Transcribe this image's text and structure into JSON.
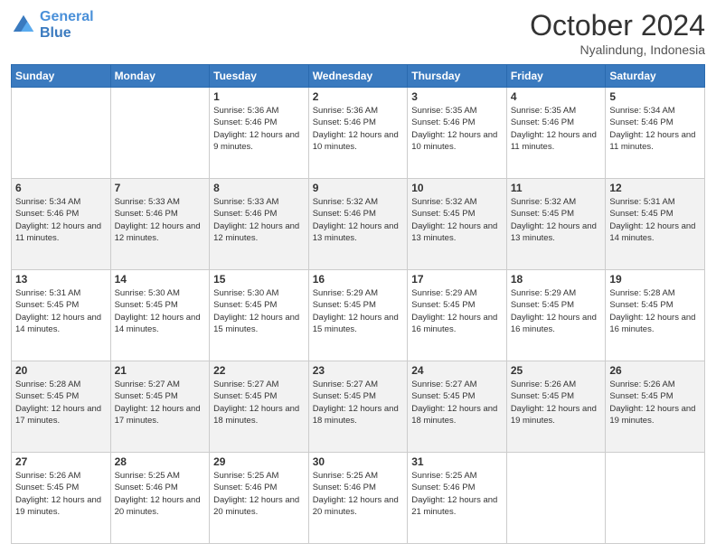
{
  "header": {
    "logo_line1": "General",
    "logo_line2": "Blue",
    "month": "October 2024",
    "location": "Nyalindung, Indonesia"
  },
  "weekdays": [
    "Sunday",
    "Monday",
    "Tuesday",
    "Wednesday",
    "Thursday",
    "Friday",
    "Saturday"
  ],
  "weeks": [
    [
      {
        "day": "",
        "sunrise": "",
        "sunset": "",
        "daylight": ""
      },
      {
        "day": "",
        "sunrise": "",
        "sunset": "",
        "daylight": ""
      },
      {
        "day": "1",
        "sunrise": "Sunrise: 5:36 AM",
        "sunset": "Sunset: 5:46 PM",
        "daylight": "Daylight: 12 hours and 9 minutes."
      },
      {
        "day": "2",
        "sunrise": "Sunrise: 5:36 AM",
        "sunset": "Sunset: 5:46 PM",
        "daylight": "Daylight: 12 hours and 10 minutes."
      },
      {
        "day": "3",
        "sunrise": "Sunrise: 5:35 AM",
        "sunset": "Sunset: 5:46 PM",
        "daylight": "Daylight: 12 hours and 10 minutes."
      },
      {
        "day": "4",
        "sunrise": "Sunrise: 5:35 AM",
        "sunset": "Sunset: 5:46 PM",
        "daylight": "Daylight: 12 hours and 11 minutes."
      },
      {
        "day": "5",
        "sunrise": "Sunrise: 5:34 AM",
        "sunset": "Sunset: 5:46 PM",
        "daylight": "Daylight: 12 hours and 11 minutes."
      }
    ],
    [
      {
        "day": "6",
        "sunrise": "Sunrise: 5:34 AM",
        "sunset": "Sunset: 5:46 PM",
        "daylight": "Daylight: 12 hours and 11 minutes."
      },
      {
        "day": "7",
        "sunrise": "Sunrise: 5:33 AM",
        "sunset": "Sunset: 5:46 PM",
        "daylight": "Daylight: 12 hours and 12 minutes."
      },
      {
        "day": "8",
        "sunrise": "Sunrise: 5:33 AM",
        "sunset": "Sunset: 5:46 PM",
        "daylight": "Daylight: 12 hours and 12 minutes."
      },
      {
        "day": "9",
        "sunrise": "Sunrise: 5:32 AM",
        "sunset": "Sunset: 5:46 PM",
        "daylight": "Daylight: 12 hours and 13 minutes."
      },
      {
        "day": "10",
        "sunrise": "Sunrise: 5:32 AM",
        "sunset": "Sunset: 5:45 PM",
        "daylight": "Daylight: 12 hours and 13 minutes."
      },
      {
        "day": "11",
        "sunrise": "Sunrise: 5:32 AM",
        "sunset": "Sunset: 5:45 PM",
        "daylight": "Daylight: 12 hours and 13 minutes."
      },
      {
        "day": "12",
        "sunrise": "Sunrise: 5:31 AM",
        "sunset": "Sunset: 5:45 PM",
        "daylight": "Daylight: 12 hours and 14 minutes."
      }
    ],
    [
      {
        "day": "13",
        "sunrise": "Sunrise: 5:31 AM",
        "sunset": "Sunset: 5:45 PM",
        "daylight": "Daylight: 12 hours and 14 minutes."
      },
      {
        "day": "14",
        "sunrise": "Sunrise: 5:30 AM",
        "sunset": "Sunset: 5:45 PM",
        "daylight": "Daylight: 12 hours and 14 minutes."
      },
      {
        "day": "15",
        "sunrise": "Sunrise: 5:30 AM",
        "sunset": "Sunset: 5:45 PM",
        "daylight": "Daylight: 12 hours and 15 minutes."
      },
      {
        "day": "16",
        "sunrise": "Sunrise: 5:29 AM",
        "sunset": "Sunset: 5:45 PM",
        "daylight": "Daylight: 12 hours and 15 minutes."
      },
      {
        "day": "17",
        "sunrise": "Sunrise: 5:29 AM",
        "sunset": "Sunset: 5:45 PM",
        "daylight": "Daylight: 12 hours and 16 minutes."
      },
      {
        "day": "18",
        "sunrise": "Sunrise: 5:29 AM",
        "sunset": "Sunset: 5:45 PM",
        "daylight": "Daylight: 12 hours and 16 minutes."
      },
      {
        "day": "19",
        "sunrise": "Sunrise: 5:28 AM",
        "sunset": "Sunset: 5:45 PM",
        "daylight": "Daylight: 12 hours and 16 minutes."
      }
    ],
    [
      {
        "day": "20",
        "sunrise": "Sunrise: 5:28 AM",
        "sunset": "Sunset: 5:45 PM",
        "daylight": "Daylight: 12 hours and 17 minutes."
      },
      {
        "day": "21",
        "sunrise": "Sunrise: 5:27 AM",
        "sunset": "Sunset: 5:45 PM",
        "daylight": "Daylight: 12 hours and 17 minutes."
      },
      {
        "day": "22",
        "sunrise": "Sunrise: 5:27 AM",
        "sunset": "Sunset: 5:45 PM",
        "daylight": "Daylight: 12 hours and 18 minutes."
      },
      {
        "day": "23",
        "sunrise": "Sunrise: 5:27 AM",
        "sunset": "Sunset: 5:45 PM",
        "daylight": "Daylight: 12 hours and 18 minutes."
      },
      {
        "day": "24",
        "sunrise": "Sunrise: 5:27 AM",
        "sunset": "Sunset: 5:45 PM",
        "daylight": "Daylight: 12 hours and 18 minutes."
      },
      {
        "day": "25",
        "sunrise": "Sunrise: 5:26 AM",
        "sunset": "Sunset: 5:45 PM",
        "daylight": "Daylight: 12 hours and 19 minutes."
      },
      {
        "day": "26",
        "sunrise": "Sunrise: 5:26 AM",
        "sunset": "Sunset: 5:45 PM",
        "daylight": "Daylight: 12 hours and 19 minutes."
      }
    ],
    [
      {
        "day": "27",
        "sunrise": "Sunrise: 5:26 AM",
        "sunset": "Sunset: 5:45 PM",
        "daylight": "Daylight: 12 hours and 19 minutes."
      },
      {
        "day": "28",
        "sunrise": "Sunrise: 5:25 AM",
        "sunset": "Sunset: 5:46 PM",
        "daylight": "Daylight: 12 hours and 20 minutes."
      },
      {
        "day": "29",
        "sunrise": "Sunrise: 5:25 AM",
        "sunset": "Sunset: 5:46 PM",
        "daylight": "Daylight: 12 hours and 20 minutes."
      },
      {
        "day": "30",
        "sunrise": "Sunrise: 5:25 AM",
        "sunset": "Sunset: 5:46 PM",
        "daylight": "Daylight: 12 hours and 20 minutes."
      },
      {
        "day": "31",
        "sunrise": "Sunrise: 5:25 AM",
        "sunset": "Sunset: 5:46 PM",
        "daylight": "Daylight: 12 hours and 21 minutes."
      },
      {
        "day": "",
        "sunrise": "",
        "sunset": "",
        "daylight": ""
      },
      {
        "day": "",
        "sunrise": "",
        "sunset": "",
        "daylight": ""
      }
    ]
  ]
}
